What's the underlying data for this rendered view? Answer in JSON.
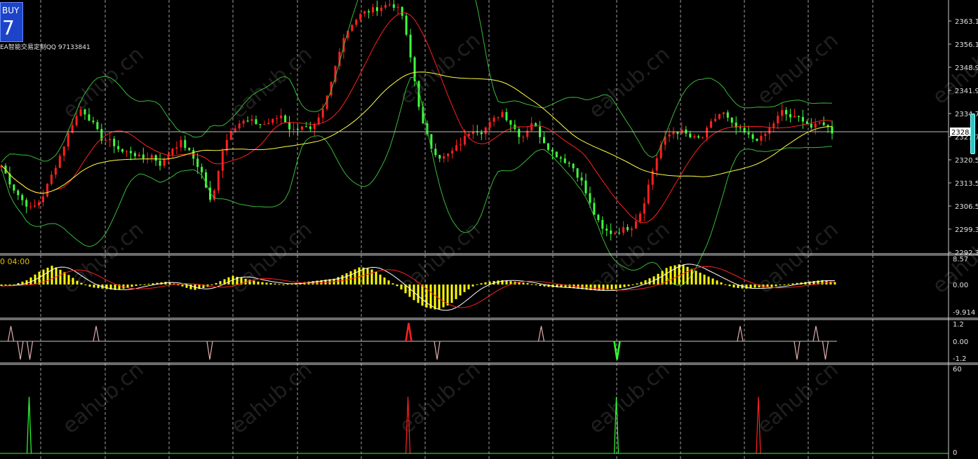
{
  "header": {
    "buy_label": "BUY",
    "buy_value": "7",
    "promo_text": "EA智能交易定制QQ 97133841"
  },
  "watermark": "eahub.cn",
  "colors": {
    "background": "#000000",
    "grid": "#b8b8b8",
    "candle_up": "#ff2020",
    "candle_down": "#40ff40",
    "bollinger": "#3ab83a",
    "ma_fast": "#ff2020",
    "ma_slow": "#ffff40",
    "macd_hist": "#ffff00",
    "macd_line": "#ffffff",
    "signal_line": "#ff2020",
    "bid_line": "#c0c0c0"
  },
  "chart_data": [
    {
      "type": "candlestick",
      "panel": "price",
      "title": "",
      "y_tick_labels": [
        "2363.10",
        "2356.10",
        "2348.90",
        "2341.90",
        "2334.70",
        "2327.70",
        "2320.50",
        "2313.50",
        "2306.50",
        "2299.30",
        "2292.30"
      ],
      "ylim": [
        2292.3,
        2367.0
      ],
      "current_price": "2328.00",
      "current_price_value": 2328.0,
      "overlays": [
        "bollinger bands",
        "moving average (red)",
        "moving average (yellow)"
      ],
      "close_series": [
        2318,
        2312,
        2308,
        2305,
        2308,
        2315,
        2322,
        2330,
        2335,
        2331,
        2326,
        2325,
        2322,
        2322,
        2320,
        2321,
        2318,
        2323,
        2325,
        2321,
        2316,
        2306,
        2322,
        2329,
        2331,
        2331,
        2330,
        2331,
        2333,
        2328,
        2330,
        2328,
        2333,
        2343,
        2355,
        2360,
        2363,
        2364,
        2365,
        2366,
        2363,
        2348,
        2331,
        2323,
        2320,
        2322,
        2325,
        2329,
        2328,
        2331,
        2334,
        2330,
        2326,
        2331,
        2326,
        2322,
        2320,
        2318,
        2313,
        2305,
        2299,
        2298,
        2299,
        2300,
        2305,
        2316,
        2325,
        2328,
        2328,
        2326,
        2326,
        2331,
        2334,
        2330,
        2328,
        2326,
        2326,
        2330,
        2334,
        2332,
        2332,
        2329,
        2331,
        2328
      ]
    },
    {
      "type": "macd",
      "panel": "indicator-1",
      "title": "0 04:00",
      "y_tick_labels": [
        "8.57",
        "0.00",
        "-9.914"
      ],
      "ylim": [
        -9.914,
        8.57
      ],
      "histogram": [
        -0.5,
        0,
        1.5,
        4.5,
        6.5,
        4,
        1,
        -1,
        -1.5,
        -2,
        -1,
        0,
        0.5,
        1,
        -0.5,
        -2,
        -1,
        1,
        3,
        2,
        1,
        0.5,
        0,
        0.5,
        1,
        1.5,
        2,
        4,
        6,
        5,
        2,
        -1,
        -5,
        -8,
        -9,
        -7,
        -3,
        0,
        1,
        1.5,
        1,
        0.5,
        -0.5,
        -1,
        -1,
        -1.5,
        -2,
        -2,
        -1.5,
        -0.5,
        1,
        3,
        6,
        7,
        5,
        3,
        1,
        -1,
        -1.5,
        -1,
        -1,
        0,
        0.5,
        1,
        1.5,
        0.8
      ]
    },
    {
      "type": "line",
      "panel": "indicator-2",
      "title": "",
      "y_tick_labels": [
        "1.2",
        "0.00",
        "-1.2"
      ],
      "ylim": [
        -1.2,
        1.2
      ],
      "spikes": [
        {
          "bar": 1,
          "value": 1.0
        },
        {
          "bar": 2,
          "value": -1.2
        },
        {
          "bar": 3,
          "value": -1.2
        },
        {
          "bar": 10,
          "value": 1.0
        },
        {
          "bar": 22,
          "value": -1.2
        },
        {
          "bar": 43,
          "value": 1.2,
          "highlight": "red"
        },
        {
          "bar": 46,
          "value": -1.2
        },
        {
          "bar": 57,
          "value": 1.0
        },
        {
          "bar": 65,
          "value": -1.2,
          "highlight": "green"
        },
        {
          "bar": 78,
          "value": 1.0
        },
        {
          "bar": 84,
          "value": -1.2
        },
        {
          "bar": 86,
          "value": 1.0
        },
        {
          "bar": 87,
          "value": -1.2
        }
      ]
    },
    {
      "type": "line",
      "panel": "indicator-3",
      "title": "",
      "y_tick_labels": [
        "60",
        "0"
      ],
      "ylim": [
        0,
        60
      ],
      "spikes": [
        {
          "bar": 3,
          "value": 40,
          "color": "green"
        },
        {
          "bar": 43,
          "value": 40,
          "color": "red"
        },
        {
          "bar": 65,
          "value": 40,
          "color": "green"
        },
        {
          "bar": 80,
          "value": 40,
          "color": "red"
        }
      ]
    }
  ]
}
